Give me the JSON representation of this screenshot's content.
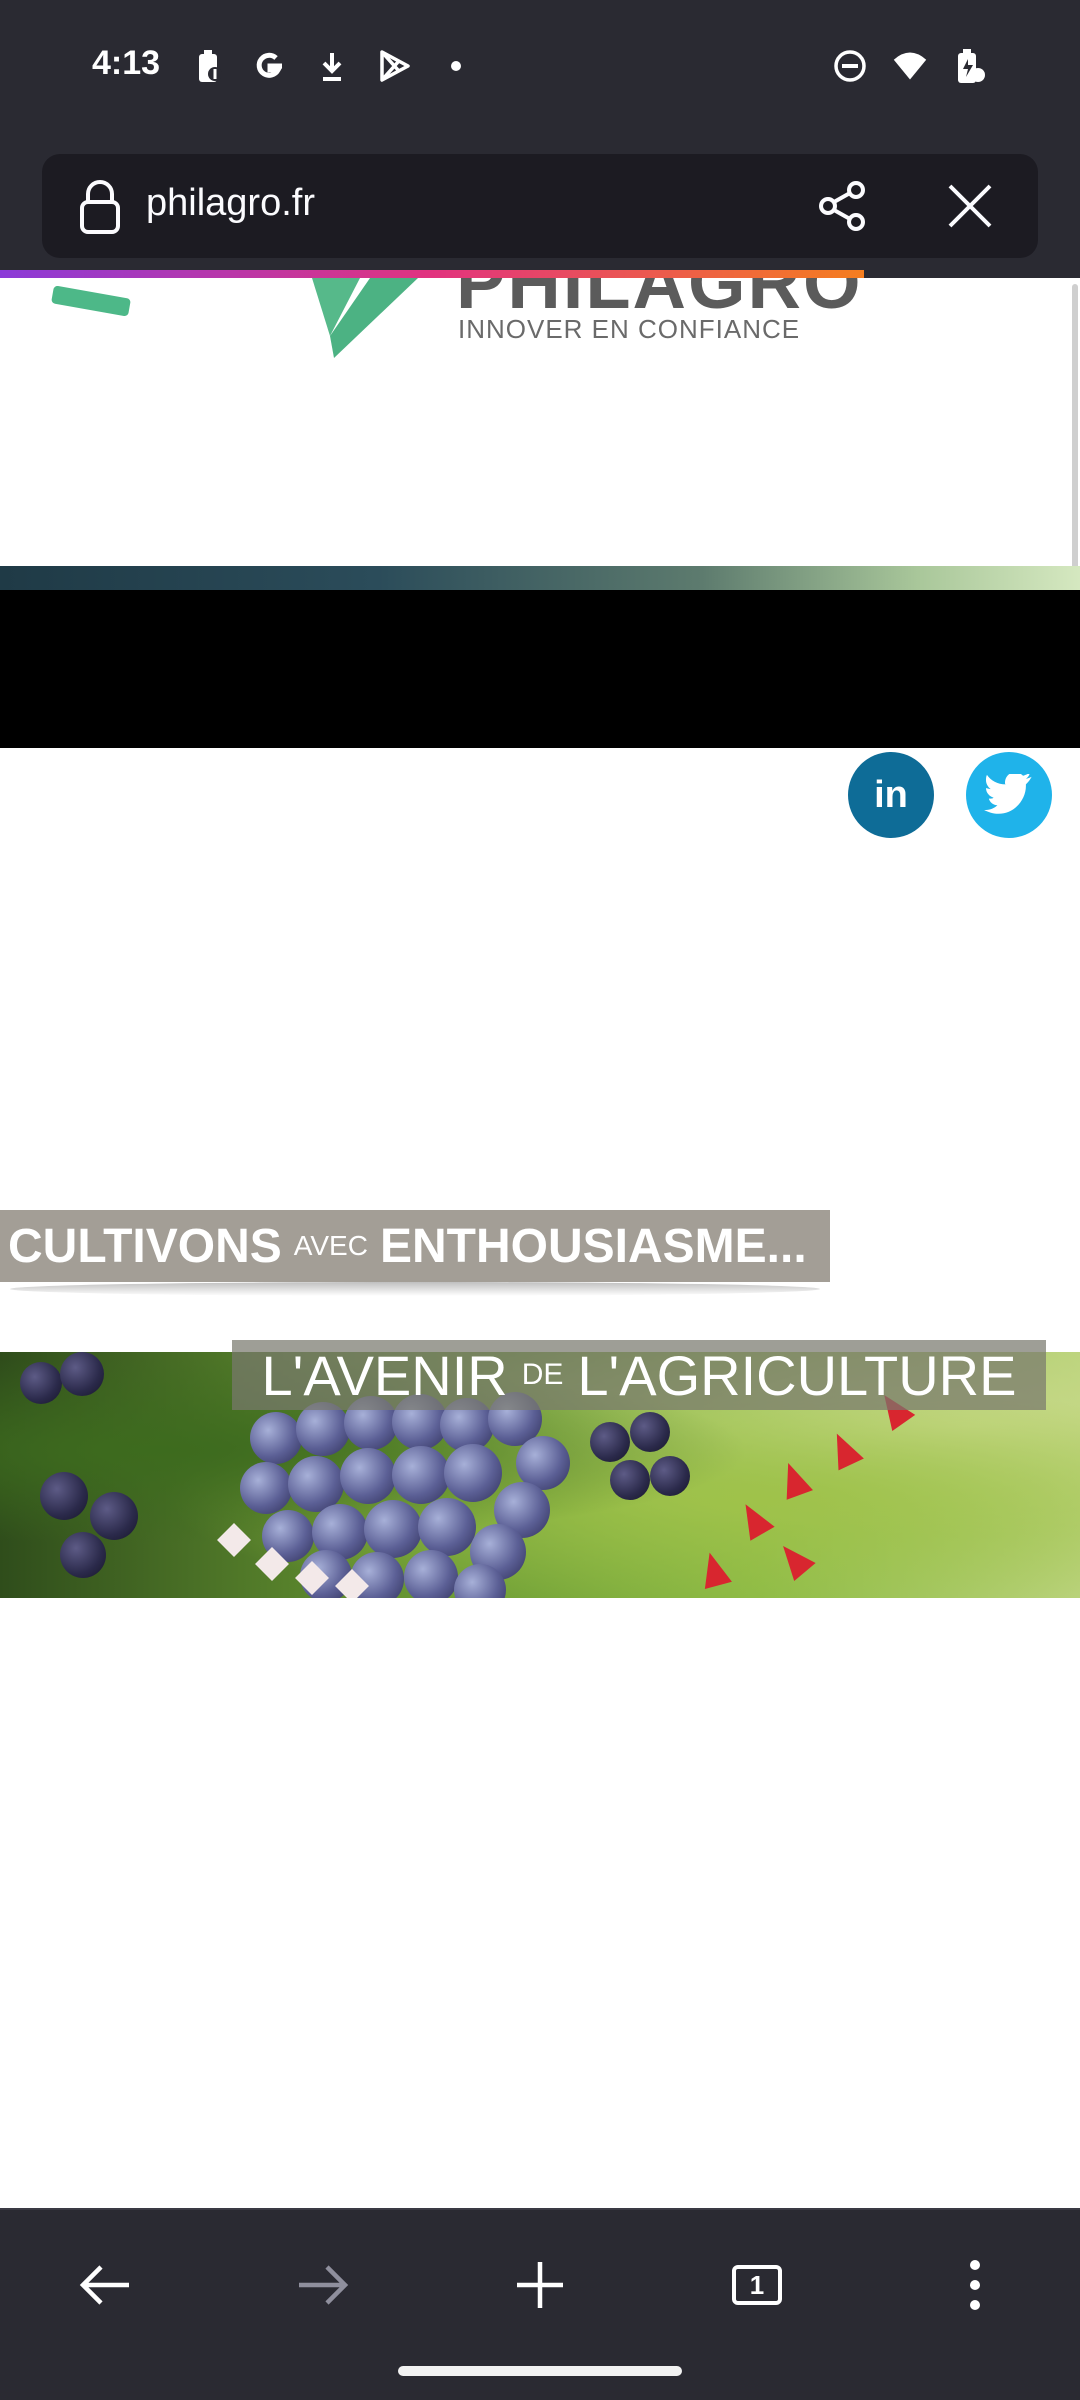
{
  "status_bar": {
    "time": "4:13",
    "left_icons": [
      "battery-saver-icon",
      "google-icon",
      "download-icon",
      "play-store-icon",
      "dot-icon"
    ],
    "right_icons": [
      "do-not-disturb-icon",
      "wifi-icon",
      "battery-charging-icon"
    ]
  },
  "browser": {
    "url": "philagro.fr",
    "share_icon": "share-icon",
    "close_icon": "close-icon",
    "load_progress": 0.8
  },
  "page": {
    "logo_name": "PHILAGRO",
    "logo_tagline": "INNOVER EN CONFIANCE",
    "social_linkedin": "in",
    "social_twitter": "twitter-icon",
    "slogan1_a": "CULTIVONS",
    "slogan1_small": "AVEC",
    "slogan1_b": "ENTHOUSIASME...",
    "slogan2_a": "L'AVENIR",
    "slogan2_small": "DE",
    "slogan2_b": "L'AGRICULTURE"
  },
  "toolbar": {
    "tab_count": "1",
    "back_icon": "back-arrow-icon",
    "forward_icon": "forward-arrow-icon",
    "new_tab_icon": "plus-icon",
    "menu_icon": "more-vert-icon"
  },
  "colors": {
    "chrome_bg": "#2a2a32",
    "linkedin": "#0e6c97",
    "twitter": "#1fb3ea",
    "logo_green": "#4db888"
  }
}
